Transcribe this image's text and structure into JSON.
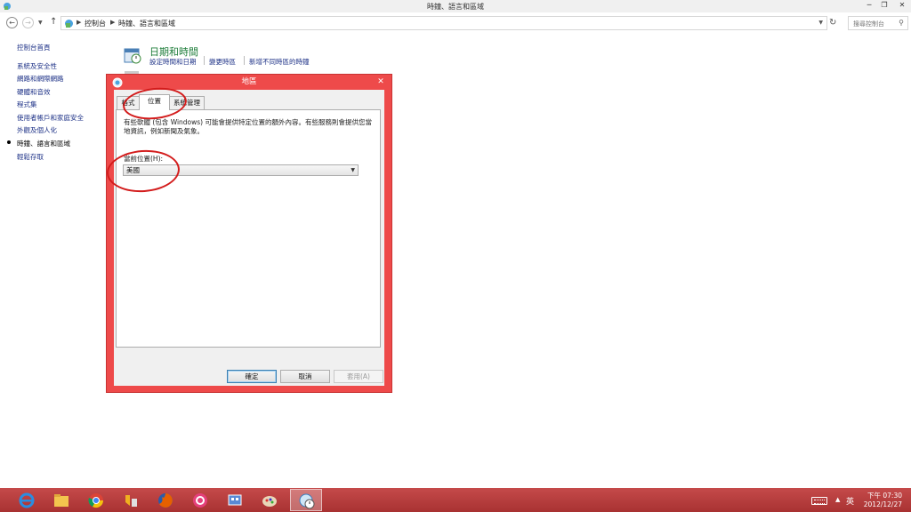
{
  "window": {
    "title": "時鐘、語言和區域",
    "min_glyph": "─",
    "max_glyph": "❐",
    "close_glyph": "✕"
  },
  "addressbar": {
    "breadcrumbs": [
      "控制台",
      "時鐘、語言和區域"
    ],
    "search_placeholder": "搜尋控制台"
  },
  "sidebar": {
    "home": "控制台首頁",
    "items": [
      "系統及安全性",
      "網路和網際網路",
      "硬體和音效",
      "程式集",
      "使用者帳戶和家庭安全",
      "外觀及個人化",
      "時鐘、語言和區域",
      "輕鬆存取"
    ],
    "current_index": 6
  },
  "main": {
    "heading": "日期和時間",
    "links": [
      "設定時間和日期",
      "變更時區",
      "新增不同時區的時鐘"
    ]
  },
  "dialog": {
    "title": "地區",
    "close_glyph": "✕",
    "tabs": [
      "格式",
      "位置",
      "系統管理"
    ],
    "active_tab": 1,
    "description": "有些軟體 (包含 Windows) 可能會提供特定位置的額外內容。有些服務則會提供您當地資訊，例如新聞及氣象。",
    "location_label": "當前位置(H):",
    "location_value": "美國",
    "buttons": {
      "ok": "確定",
      "cancel": "取消",
      "apply": "套用(A)"
    }
  },
  "taskbar": {
    "apps": [
      "internet-explorer",
      "file-explorer",
      "chrome",
      "app-4",
      "firefox",
      "app-6",
      "app-7",
      "paint",
      "control-panel"
    ],
    "active_index": 8,
    "ime": "英",
    "time": "下午 07:30",
    "date": "2012/12/27"
  },
  "colors": {
    "dialog_frame": "#ee4a4a",
    "taskbar": "#b83c3c",
    "link": "#1e3287",
    "heading_green": "#1e7d3a",
    "annotation": "#d31c1c"
  }
}
